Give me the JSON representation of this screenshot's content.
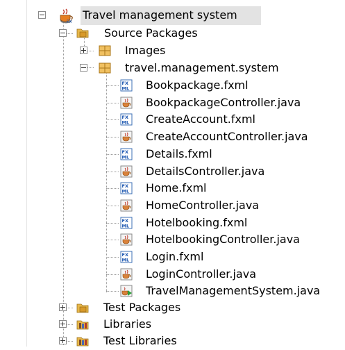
{
  "tree": {
    "root": {
      "label": "Travel management system",
      "icon": "java-project-icon"
    },
    "source_packages": {
      "label": "Source Packages",
      "icon": "source-folder-icon"
    },
    "images": {
      "label": "Images",
      "icon": "package-icon"
    },
    "package": {
      "label": "travel.management.system",
      "icon": "package-icon"
    },
    "files": [
      {
        "label": "Bookpackage.fxml",
        "icon": "fxml-file-icon"
      },
      {
        "label": "BookpackageController.java",
        "icon": "java-file-icon"
      },
      {
        "label": "CreateAccount.fxml",
        "icon": "fxml-file-icon"
      },
      {
        "label": "CreateAccountController.java",
        "icon": "java-file-icon"
      },
      {
        "label": "Details.fxml",
        "icon": "fxml-file-icon"
      },
      {
        "label": "DetailsController.java",
        "icon": "java-file-icon"
      },
      {
        "label": "Home.fxml",
        "icon": "fxml-file-icon"
      },
      {
        "label": "HomeController.java",
        "icon": "java-file-icon"
      },
      {
        "label": "Hotelbooking.fxml",
        "icon": "fxml-file-icon"
      },
      {
        "label": "HotelbookingController.java",
        "icon": "java-file-icon"
      },
      {
        "label": "Login.fxml",
        "icon": "fxml-file-icon"
      },
      {
        "label": "LoginController.java",
        "icon": "java-file-icon"
      },
      {
        "label": "TravelManagementSystem.java",
        "icon": "java-main-class-icon"
      }
    ],
    "test_packages": {
      "label": "Test Packages",
      "icon": "source-folder-icon"
    },
    "libraries": {
      "label": "Libraries",
      "icon": "library-folder-icon"
    },
    "test_libraries": {
      "label": "Test Libraries",
      "icon": "library-folder-icon"
    }
  },
  "colors": {
    "selection": "#e3e3e3",
    "folder": "#e8b84a",
    "package": "#e6a93a",
    "fxml": "#3b6fb6",
    "java": "#d9823b"
  }
}
